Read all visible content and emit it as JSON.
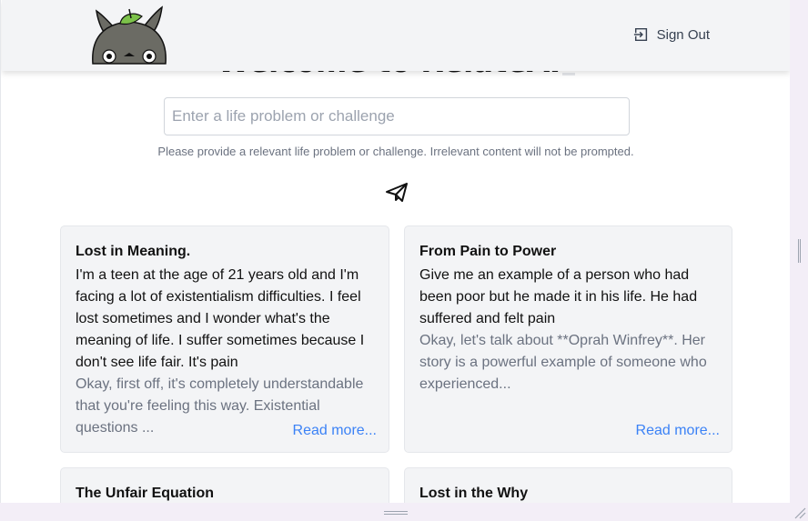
{
  "header": {
    "title": "Welcome to RelateAI",
    "signout_label": "Sign Out",
    "logo_icon": "totoro-mascot-logo"
  },
  "search": {
    "value": "",
    "placeholder": "Enter a life problem or challenge",
    "hint": "Please provide a relevant life problem or challenge. Irrelevant content will not be prompted."
  },
  "cards": [
    {
      "title": "Lost in Meaning.",
      "question": "I'm a teen at the age of 21 years old and I'm facing a lot of existentialism difficulties. I feel lost sometimes and I wonder what's the meaning of life. I suffer sometimes because I don't see life fair. It's pain",
      "answer": "Okay, first off, it's completely understandable that you're feeling this way. Existential questions ...",
      "more": "Read more..."
    },
    {
      "title": "From Pain to Power",
      "question": "Give me an example of a person who had been poor but he made it in his life. He had suffered and felt pain",
      "answer": "Okay, let's talk about **Oprah Winfrey**. Her story is a powerful example of someone who experienced...",
      "more": "Read more..."
    },
    {
      "title": "The Unfair Equation"
    },
    {
      "title": "Lost in the Why"
    }
  ],
  "colors": {
    "topbar": "#f3f4f6",
    "card_bg": "#f3f4f6",
    "link": "#3b82f6",
    "muted_text": "#6b7280"
  }
}
